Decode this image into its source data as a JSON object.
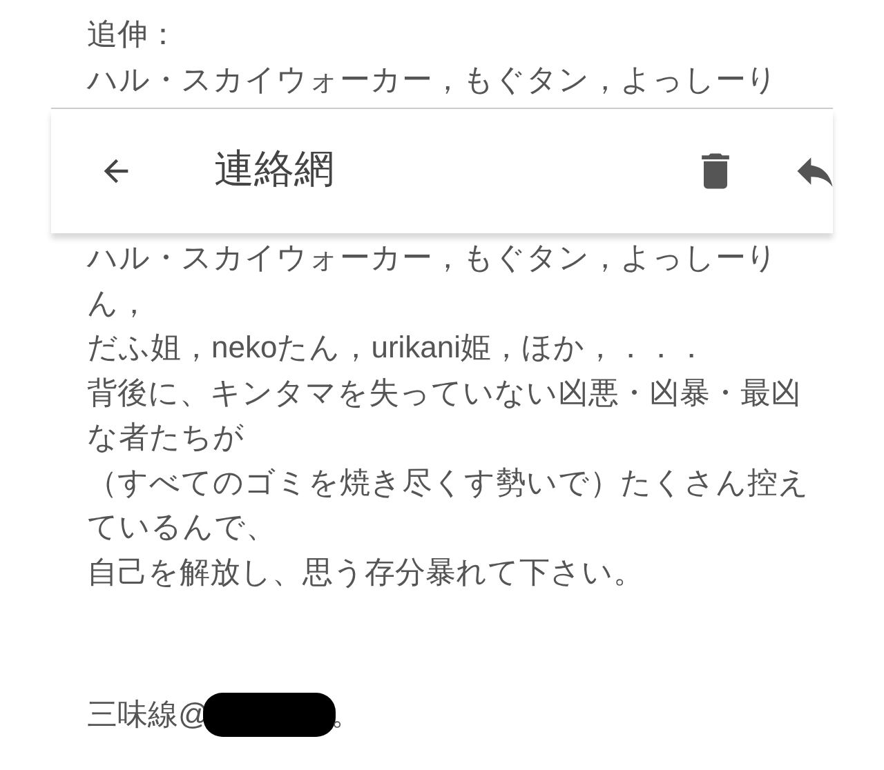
{
  "previous_screen": {
    "lines": [
      "追伸：",
      "ハル・スカイウォーカー，もぐタン，よっしーり"
    ]
  },
  "toolbar": {
    "title": "連絡網"
  },
  "body": {
    "lines": [
      "ハル・スカイウォーカー，もぐタン，よっしーり",
      "ん，",
      "だふ姐，nekoたん，urikani姫，ほか，．．．",
      "背後に、キンタマを失っていない凶悪・凶暴・最凶",
      "な者たちが",
      "（すべてのゴミを焼き尽くす勢いで）たくさん控え",
      "ているんで、",
      "自己を解放し、思う存分暴れて下さい。"
    ]
  },
  "signature": {
    "before": "三味線@",
    "redacted": true,
    "after": "。"
  }
}
